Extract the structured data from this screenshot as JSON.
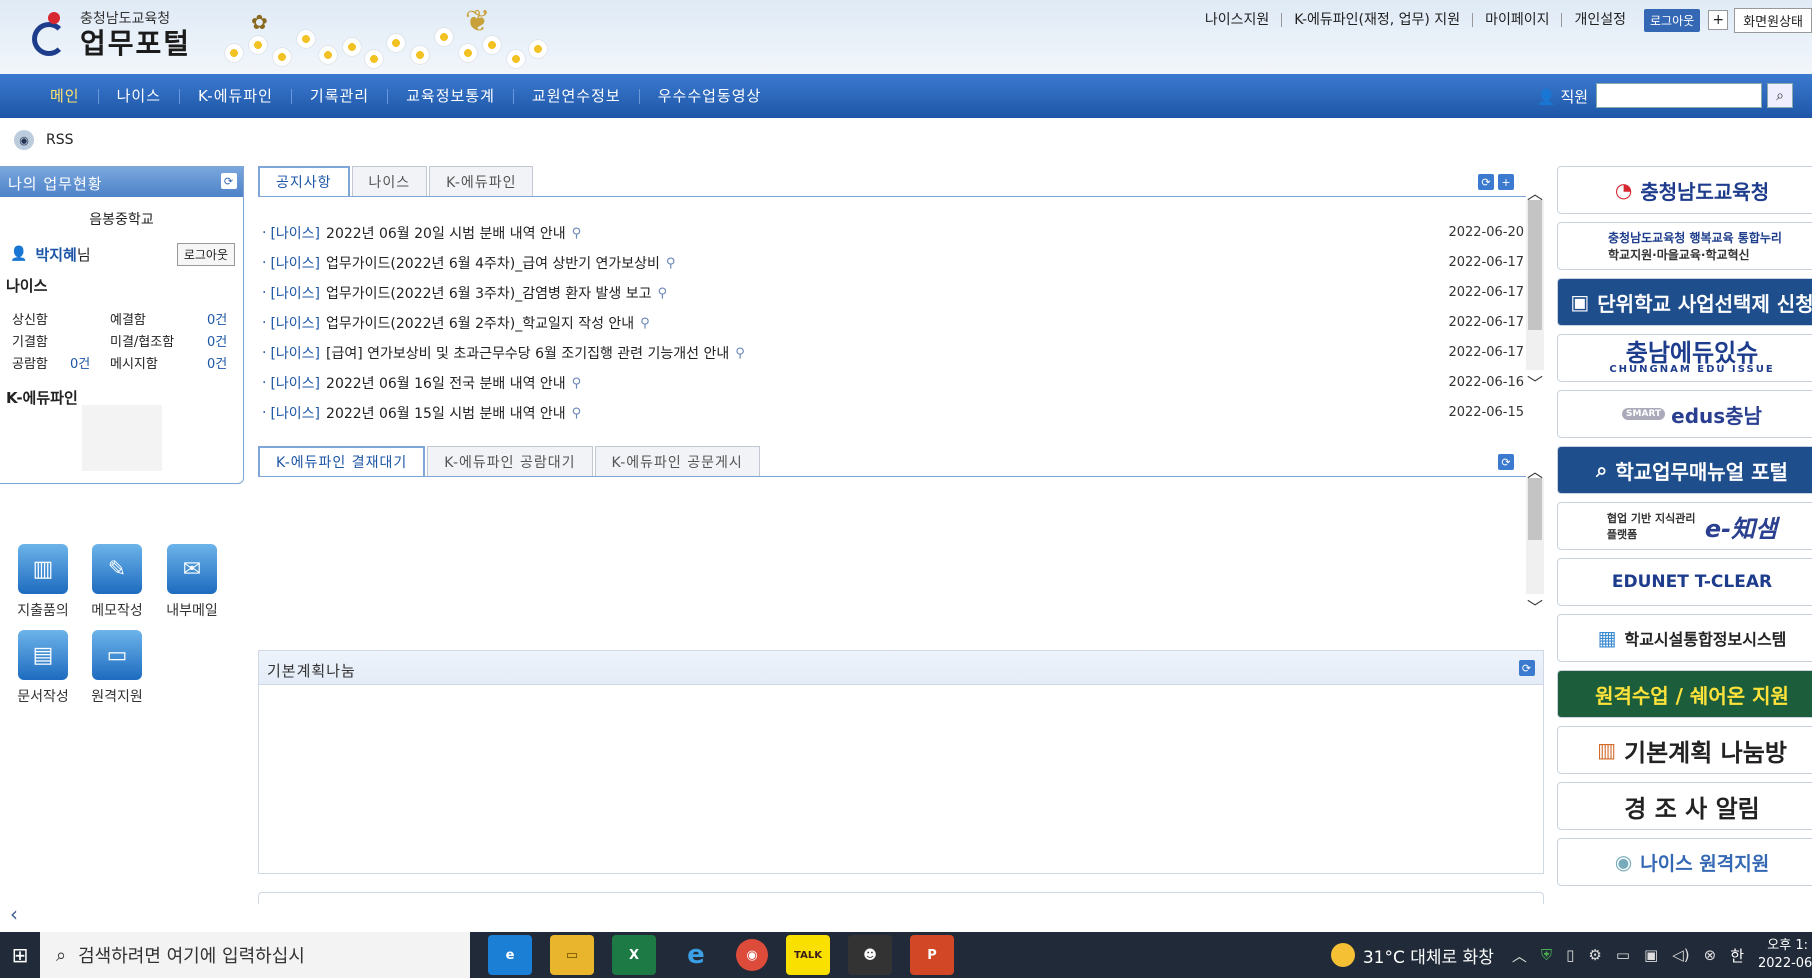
{
  "header": {
    "logo_org": "충청남도교육청",
    "logo_name": "업무포털",
    "links": [
      "나이스지원",
      "K-에듀파인(재정, 업무) 지원",
      "마이페이지",
      "개인설정"
    ],
    "logout_label": "로그아웃",
    "plus_label": "+",
    "screen_label": "화면원상태"
  },
  "nav": {
    "items": [
      "메인",
      "나이스",
      "K-에듀파인",
      "기록관리",
      "교육정보통계",
      "교원연수정보",
      "우수수업동영상"
    ],
    "search_label": "직원",
    "search_placeholder": ""
  },
  "rss_label": "RSS",
  "work_status": {
    "title": "나의 업무현황",
    "school": "음봉중학교",
    "user_name": "박지혜",
    "user_suffix": "님",
    "logout_label": "로그아웃",
    "neis_title": "나이스",
    "stats": [
      {
        "label": "상신함",
        "count": ""
      },
      {
        "label": "예결함",
        "count": "0건"
      },
      {
        "label": "기결함",
        "count": ""
      },
      {
        "label": "미결/협조함",
        "count": "0건"
      },
      {
        "label": "공람함",
        "count": "0건"
      },
      {
        "label": "메시지함",
        "count": "0건"
      }
    ],
    "kedu_title": "K-에듀파인"
  },
  "quick_icons": [
    {
      "label": "지출품의",
      "icon": "chart-icon"
    },
    {
      "label": "메모작성",
      "icon": "pencil-icon"
    },
    {
      "label": "내부메일",
      "icon": "mail-icon"
    },
    {
      "label": "문서작성",
      "icon": "document-icon"
    },
    {
      "label": "원격지원",
      "icon": "monitor-icon"
    }
  ],
  "notice_panel": {
    "tabs": [
      "공지사항",
      "나이스",
      "K-에듀파인"
    ],
    "items": [
      {
        "category": "[나이스]",
        "title": "2022년 06월 20일 시범 분배 내역 안내",
        "date": "2022-06-20"
      },
      {
        "category": "[나이스]",
        "title": "업무가이드(2022년 6월 4주차)_급여 상반기 연가보상비",
        "date": "2022-06-17"
      },
      {
        "category": "[나이스]",
        "title": "업무가이드(2022년 6월 3주차)_감염병 환자 발생 보고",
        "date": "2022-06-17"
      },
      {
        "category": "[나이스]",
        "title": "업무가이드(2022년 6월 2주차)_학교일지 작성 안내",
        "date": "2022-06-17"
      },
      {
        "category": "[나이스]",
        "title": "[급여] 연가보상비 및 초과근무수당 6월 조기집행 관련 기능개선 안내",
        "date": "2022-06-17"
      },
      {
        "category": "[나이스]",
        "title": "2022년 06월 16일 전국 분배 내역 안내",
        "date": "2022-06-16"
      },
      {
        "category": "[나이스]",
        "title": "2022년 06월 15일 시범 분배 내역 안내",
        "date": "2022-06-15"
      }
    ]
  },
  "kedu_panel": {
    "tabs": [
      "K-에듀파인 결재대기",
      "K-에듀파인 공람대기",
      "K-에듀파인 공문게시"
    ]
  },
  "plan_panel": {
    "title": "기본계획나눔"
  },
  "banners": [
    {
      "text": "충청남도교육청",
      "style": "light"
    },
    {
      "text": "충청남도교육청 행복교육 통합누리",
      "sub": "학교지원·마을교육·학교혁신",
      "style": "light"
    },
    {
      "text": "단위학교 사업선택제 신청",
      "style": "dark"
    },
    {
      "text": "충남에듀있슈",
      "sub": "CHUNGNAM EDU ISSUE",
      "style": "light"
    },
    {
      "text": "edus충남",
      "badge": "SMART",
      "style": "light"
    },
    {
      "text": "학교업무매뉴얼 포털",
      "style": "dark"
    },
    {
      "text": "e-知샘",
      "sub": "협업 기반 지식관리 플랫폼",
      "style": "light"
    },
    {
      "text": "EDUNET T-CLEAR",
      "style": "light"
    },
    {
      "text": "학교시설통합정보시스템",
      "style": "light"
    },
    {
      "text": "원격수업 / 쉐어온 지원",
      "style": "green"
    },
    {
      "text": "기본계획 나눔방",
      "style": "light"
    },
    {
      "text": "경 조 사 알림",
      "style": "light"
    },
    {
      "text": "나이스 원격지원",
      "style": "light"
    }
  ],
  "taskbar": {
    "search_placeholder": "검색하려면 여기에 입력하십시",
    "apps": [
      "edge",
      "file-explorer",
      "excel",
      "internet-explorer",
      "chrome",
      "kakaotalk",
      "messenger",
      "powerpoint"
    ],
    "weather": "31°C 대체로 화창",
    "ime": "한",
    "time": "오후 1:",
    "date": "2022-06"
  },
  "colors": {
    "nav": "#2a64b8",
    "accent": "#1d56a7",
    "active_nav": "#ffe36c"
  }
}
